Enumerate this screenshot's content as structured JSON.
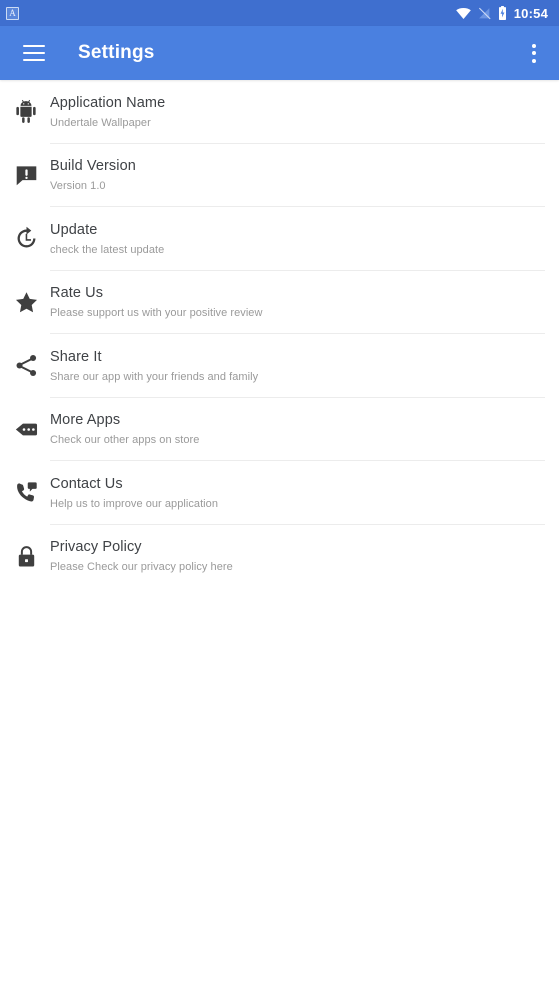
{
  "status_bar": {
    "notification_icon": "app-notification-icon",
    "notification_letter": "A",
    "wifi_icon": "wifi-icon",
    "signal_icon": "signal-off-icon",
    "battery_icon": "battery-charging-icon",
    "time": "10:54",
    "background_color": "#3f6fcf"
  },
  "toolbar": {
    "menu_icon": "hamburger-menu-icon",
    "title": "Settings",
    "overflow_icon": "more-vertical-icon",
    "background_color": "#4a80e0",
    "text_color": "#ffffff"
  },
  "list": {
    "items": [
      {
        "id": "application-name",
        "icon": "android-robot-icon",
        "title": "Application Name",
        "subtitle": "Undertale Wallpaper"
      },
      {
        "id": "build-version",
        "icon": "announcement-icon",
        "title": "Build Version",
        "subtitle": "Version 1.0"
      },
      {
        "id": "update",
        "icon": "update-refresh-icon",
        "title": "Update",
        "subtitle": "check the latest update"
      },
      {
        "id": "rate-us",
        "icon": "star-icon",
        "title": "Rate Us",
        "subtitle": "Please support us with your positive review"
      },
      {
        "id": "share-it",
        "icon": "share-icon",
        "title": "Share It",
        "subtitle": "Share our app with your friends and family"
      },
      {
        "id": "more-apps",
        "icon": "more-apps-tag-icon",
        "title": "More Apps",
        "subtitle": "Check our other apps on store"
      },
      {
        "id": "contact-us",
        "icon": "phone-in-talk-icon",
        "title": "Contact Us",
        "subtitle": "Help us to improve our application"
      },
      {
        "id": "privacy-policy",
        "icon": "lock-icon",
        "title": "Privacy Policy",
        "subtitle": "Please Check our privacy policy here"
      }
    ],
    "title_color": "#3f4246",
    "subtitle_color": "#9a9a9a",
    "divider_color": "#ececec"
  }
}
